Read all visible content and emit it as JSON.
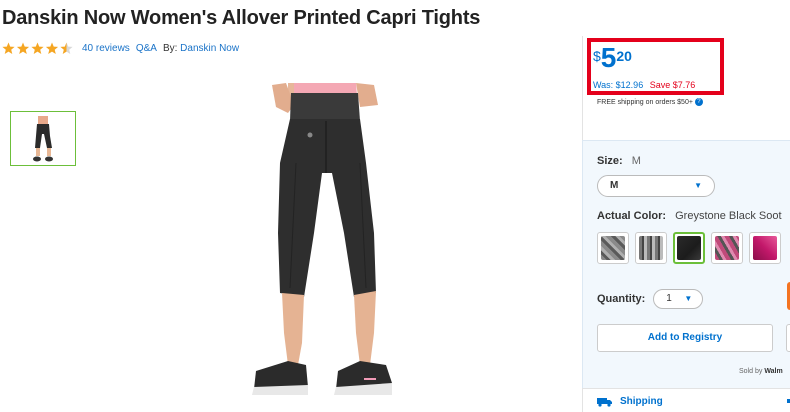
{
  "product": {
    "title": "Danskin Now Women's Allover Printed Capri Tights",
    "rating_stars": 4.5,
    "reviews_link": "40 reviews",
    "qa_link": "Q&A",
    "by_label": "By:",
    "brand_link": "Danskin Now"
  },
  "price": {
    "currency": "$",
    "dollars": "5",
    "cents": "20",
    "was": "Was: $12.96",
    "save": "Save $7.76",
    "free_shipping": "FREE shipping on orders $50+"
  },
  "options": {
    "size_label": "Size:",
    "size_value": "M",
    "size_select_value": "M",
    "color_label": "Actual Color:",
    "color_value": "Greystone Black Soot",
    "swatches": [
      {
        "name": "swatch-grey-floral",
        "colors": [
          "#8a8a8a",
          "#5a5a5a",
          "#b0b0b0"
        ]
      },
      {
        "name": "swatch-grey-geometric",
        "colors": [
          "#777",
          "#444",
          "#bbb"
        ]
      },
      {
        "name": "swatch-greystone-black-soot",
        "colors": [
          "#2a2a2a",
          "#1c1c1c",
          "#3a3a3a"
        ]
      },
      {
        "name": "swatch-pink-grey-floral",
        "colors": [
          "#c04a7a",
          "#555",
          "#e08ab0"
        ]
      },
      {
        "name": "swatch-magenta",
        "colors": [
          "#c2186a",
          "#8a0f4a",
          "#e85a9a"
        ]
      }
    ],
    "quantity_label": "Quantity:",
    "quantity_value": "1",
    "registry_button": "Add to Registry",
    "sold_by": "Sold by",
    "sold_by_name": "Walm"
  },
  "shipping": {
    "label": "Shipping"
  },
  "colors": {
    "accent_blue": "#0071ce",
    "alert_red": "#e4001b",
    "selected_green": "#6cbf3a",
    "star_gold": "#f5a623",
    "cta_orange": "#f47321"
  }
}
